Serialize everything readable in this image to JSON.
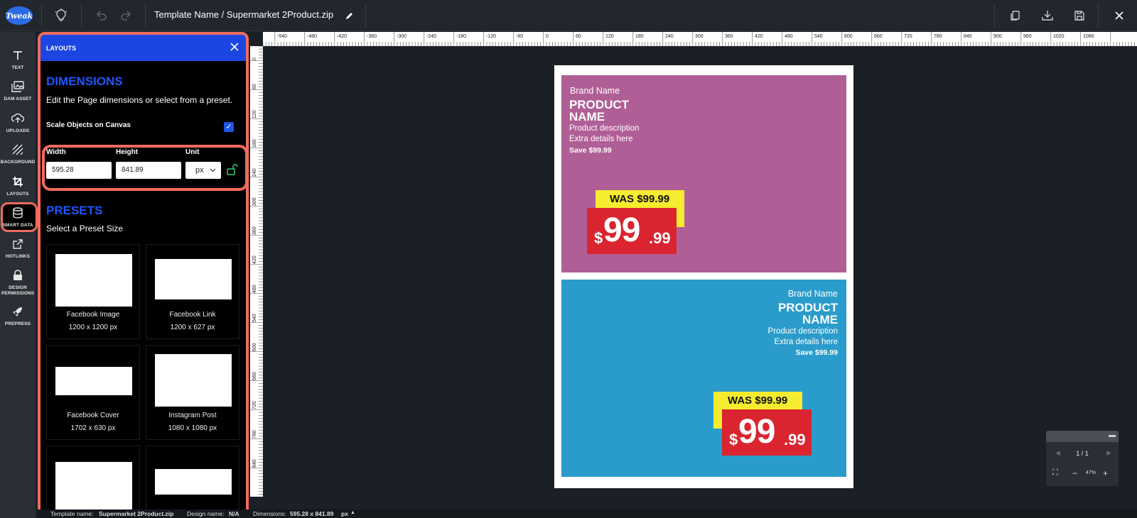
{
  "topbar": {
    "logo": "Tweak",
    "title": "Template Name / Supermarket 2Product.zip"
  },
  "rail": {
    "items": [
      {
        "label": "TEXT",
        "icon": "text-icon"
      },
      {
        "label": "DAM ASSET",
        "icon": "images-icon"
      },
      {
        "label": "UPLOADS",
        "icon": "upload-icon"
      },
      {
        "label": "BACKGROUND",
        "icon": "background-icon"
      },
      {
        "label": "LAYOUTS",
        "icon": "crop-icon"
      },
      {
        "label": "SMART DATA",
        "icon": "database-icon"
      },
      {
        "label": "HOTLINKS",
        "icon": "external-link-icon"
      },
      {
        "label": "DESIGN PERMISSIONS",
        "icon": "lock-icon"
      },
      {
        "label": "PREPRESS",
        "icon": "rocket-icon"
      }
    ]
  },
  "panel": {
    "title": "LAYOUTS",
    "dimensions_title": "DIMENSIONS",
    "dimensions_sub": "Edit the Page dimensions or select from a preset.",
    "scale_label": "Scale Objects on Canvas",
    "scale_checked": true,
    "width_label": "Width",
    "height_label": "Height",
    "unit_label": "Unit",
    "width_value": "595.28",
    "height_value": "841.89",
    "unit_value": "px",
    "presets_title": "PRESETS",
    "presets_sub": "Select a Preset Size",
    "presets": [
      {
        "name": "Facebook Image",
        "size": "1200 x 1200 px"
      },
      {
        "name": "Facebook Link",
        "size": "1200 x 627 px"
      },
      {
        "name": "Facebook Cover",
        "size": "1702 x 630 px"
      },
      {
        "name": "Instagram Post",
        "size": "1080 x 1080 px"
      }
    ]
  },
  "ruler": {
    "top": [
      "-540",
      "-480",
      "-420",
      "-360",
      "-300",
      "-240",
      "-180",
      "-120",
      "-60",
      "0",
      "60",
      "120",
      "180",
      "240",
      "300",
      "360",
      "420",
      "480",
      "540",
      "600",
      "660",
      "720",
      "780",
      "840",
      "900",
      "960",
      "1020",
      "1080"
    ],
    "left": [
      "0",
      "60",
      "120",
      "180",
      "240",
      "300",
      "360",
      "420",
      "480",
      "540",
      "600",
      "660",
      "720",
      "780",
      "840"
    ]
  },
  "cards": [
    {
      "brand": "Brand Name",
      "product_line1": "PRODUCT",
      "product_line2": "NAME",
      "desc1": "Product description",
      "desc2": "Extra details here",
      "save": "Save $99.99",
      "was": "WAS $99.99",
      "currency": "$",
      "price_main": "99",
      "price_cents": ".99",
      "color": "#b05f96"
    },
    {
      "brand": "Brand Name",
      "product_line1": "PRODUCT",
      "product_line2": "NAME",
      "desc1": "Product description",
      "desc2": "Extra details here",
      "save": "Save $99.99",
      "was": "WAS $99.99",
      "currency": "$",
      "price_main": "99",
      "price_cents": ".99",
      "color": "#2a9ccb"
    }
  ],
  "pager": {
    "page": "1 / 1",
    "zoom": "47%"
  },
  "status": {
    "template_label": "Template name:",
    "template_value": "Supermarket 2Product.zip",
    "design_label": "Design name:",
    "design_value": "N/A",
    "dimensions_label": "Dimensions:",
    "dimensions_value": "595.28 x 841.89",
    "dimensions_unit": "px"
  },
  "colors": {
    "accent_blue": "#1c46e0",
    "highlight": "#f26b5b",
    "was_yellow": "#f6ec2f",
    "price_red": "#da2530"
  }
}
